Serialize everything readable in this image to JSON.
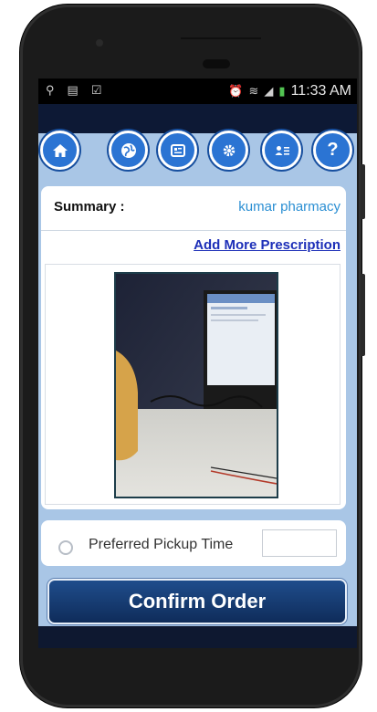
{
  "status_bar": {
    "left_icons": [
      "usb-icon",
      "download-icon",
      "sync-icon"
    ],
    "right_icons": [
      "alarm-icon",
      "wifi-icon",
      "signal-icon",
      "battery-icon"
    ],
    "time": "11:33 AM"
  },
  "nav": {
    "items": [
      {
        "name": "home-icon",
        "active": true
      },
      {
        "name": "globe-icon"
      },
      {
        "name": "news-icon"
      },
      {
        "name": "gear-icon"
      },
      {
        "name": "contacts-icon"
      },
      {
        "name": "help-icon"
      }
    ],
    "help_glyph": "?"
  },
  "summary": {
    "label": "Summary :",
    "value": "kumar pharmacy",
    "add_more_label": "Add More Prescription"
  },
  "pickup": {
    "label": "Preferred Pickup Time",
    "value": ""
  },
  "confirm_label": "Confirm Order",
  "colors": {
    "nav_blue": "#2b74d3",
    "link_blue": "#1d2fb8",
    "accent_blue": "#2b8fd3",
    "background": "#a9c6e6",
    "confirm": "#17396f"
  }
}
